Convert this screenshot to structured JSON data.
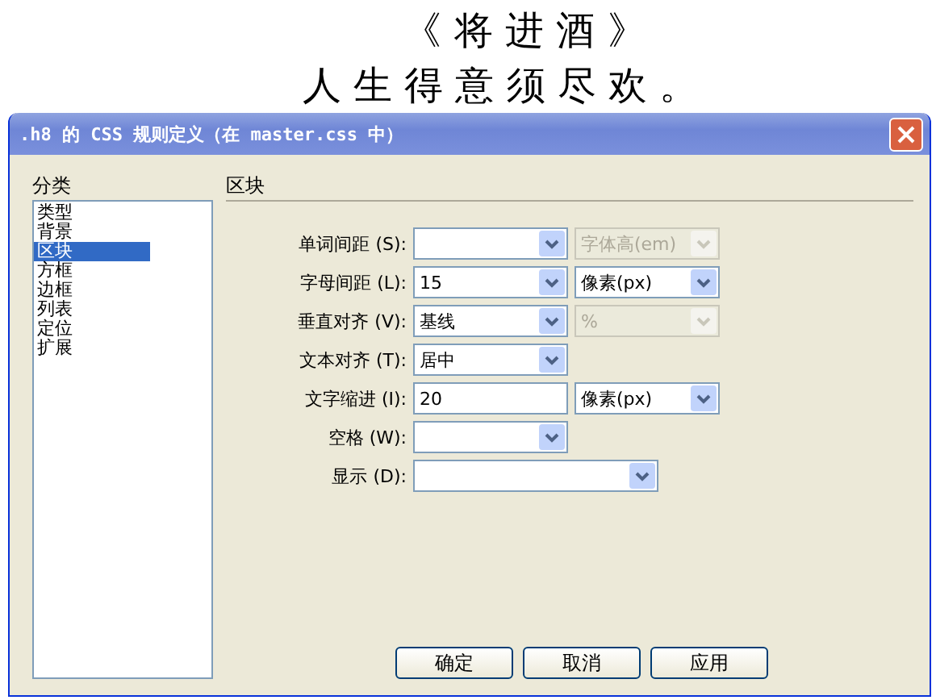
{
  "poem": {
    "title": "《 将 进 酒 》",
    "line": "人 生 得 意 须 尽 欢 。"
  },
  "window": {
    "title": ".h8 的 CSS 规则定义（在 master.css 中）"
  },
  "sidebar": {
    "heading": "分类",
    "items": [
      {
        "label": "类型",
        "selected": false
      },
      {
        "label": "背景",
        "selected": false
      },
      {
        "label": "区块",
        "selected": true
      },
      {
        "label": "方框",
        "selected": false
      },
      {
        "label": "边框",
        "selected": false
      },
      {
        "label": "列表",
        "selected": false
      },
      {
        "label": "定位",
        "selected": false
      },
      {
        "label": "扩展",
        "selected": false
      }
    ]
  },
  "panel": {
    "heading": "区块",
    "rows": [
      {
        "label": "单词间距 (S):",
        "field": {
          "kind": "combo"
        },
        "unit": {
          "value": "字体高(em)",
          "disabled": true
        }
      },
      {
        "label": "字母间距 (L):",
        "field": {
          "kind": "combo",
          "value": "15"
        },
        "unit": {
          "value": "像素(px)",
          "disabled": false
        }
      },
      {
        "label": "垂直对齐 (V):",
        "field": {
          "kind": "combo",
          "value": "基线"
        },
        "unit": {
          "value": "%",
          "disabled": true
        }
      },
      {
        "label": "文本对齐 (T):",
        "field": {
          "kind": "combo",
          "value": "居中"
        }
      },
      {
        "label": "文字缩进 (I):",
        "field": {
          "kind": "text",
          "value": "20"
        },
        "unit": {
          "value": "像素(px)",
          "disabled": false
        }
      },
      {
        "label": "空格 (W):",
        "field": {
          "kind": "combo"
        }
      },
      {
        "label": "显示 (D):",
        "field": {
          "kind": "wide-combo"
        }
      }
    ]
  },
  "buttons": [
    "确定",
    "取消",
    "应用"
  ]
}
